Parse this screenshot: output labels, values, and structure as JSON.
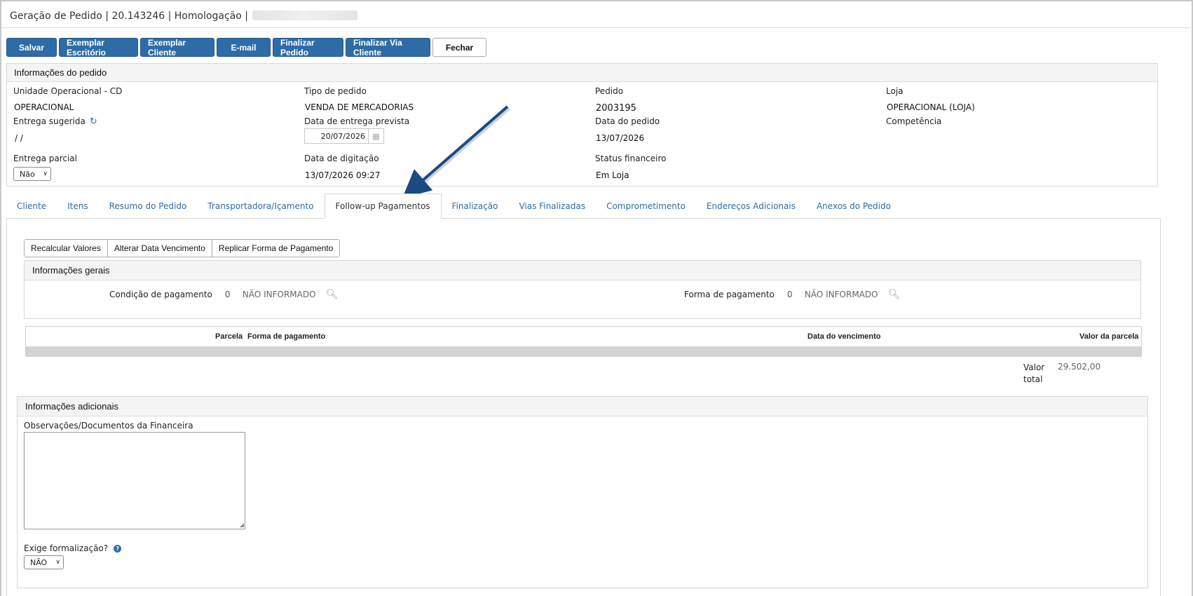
{
  "window": {
    "title": "Geração de Pedido | 20.143246 | Homologação |"
  },
  "toolbar": {
    "buttons": [
      "Salvar",
      "Exemplar Escritório",
      "Exemplar Cliente",
      "E-mail",
      "Finalizar Pedido",
      "Finalizar Via Cliente",
      "Fechar"
    ]
  },
  "order_info": {
    "header": "Informações do pedido",
    "unidade_label": "Unidade Operacional - CD",
    "unidade_value": "OPERACIONAL",
    "tipo_label": "Tipo de pedido",
    "tipo_value": "VENDA DE MERCADORIAS",
    "pedido_label": "Pedido",
    "pedido_value": "2003195",
    "loja_label": "Loja",
    "loja_value": "OPERACIONAL (LOJA)",
    "entrega_sugerida_label": "Entrega sugerida",
    "entrega_sugerida_value": "/ /",
    "data_entrega_label": "Data de entrega prevista",
    "data_entrega_value": "20/07/2026",
    "data_pedido_label": "Data do pedido",
    "data_pedido_value": "13/07/2026",
    "competencia_label": "Competência",
    "entrega_parcial_label": "Entrega parcial",
    "entrega_parcial_value": "Não",
    "data_digitacao_label": "Data de digitação",
    "data_digitacao_value": "13/07/2026 09:27",
    "status_fin_label": "Status financeiro",
    "status_fin_value": "Em Loja"
  },
  "tabs": [
    "Cliente",
    "Itens",
    "Resumo do Pedido",
    "Transportadora/Içamento",
    "Follow-up Pagamentos",
    "Finalização",
    "Vias Finalizadas",
    "Comprometimento",
    "Endereços Adicionais",
    "Anexos do Pedido"
  ],
  "active_tab": "Follow-up Pagamentos",
  "actions": [
    "Recalcular Valores",
    "Alterar Data Vencimento",
    "Replicar Forma de Pagamento"
  ],
  "general": {
    "header": "Informações gerais",
    "condicao_label": "Condição de pagamento",
    "condicao_code": "0",
    "condicao_desc": "NÃO INFORMADO",
    "forma_label": "Forma de pagamento",
    "forma_code": "0",
    "forma_desc": "NÃO INFORMADO"
  },
  "grid": {
    "columns": [
      "Parcela",
      "Forma de pagamento",
      "Data do vencimento",
      "Valor da parcela"
    ]
  },
  "total": {
    "label_line1": "Valor",
    "label_line2": "total",
    "value": "29.502,00"
  },
  "additional": {
    "header": "Informações adicionais",
    "obs_label": "Observações/Documentos da Financeira",
    "formalizacao_label": "Exige formalização?",
    "formalizacao_value": "NÃO"
  },
  "colors": {
    "primary": "#2e6ca8",
    "link": "#2e6ca8",
    "arrow": "#1b4a80"
  },
  "icons": [
    "refresh-icon",
    "calendar-icon",
    "search-icon",
    "help-icon",
    "chevron-down-icon",
    "resize-grip-icon"
  ]
}
